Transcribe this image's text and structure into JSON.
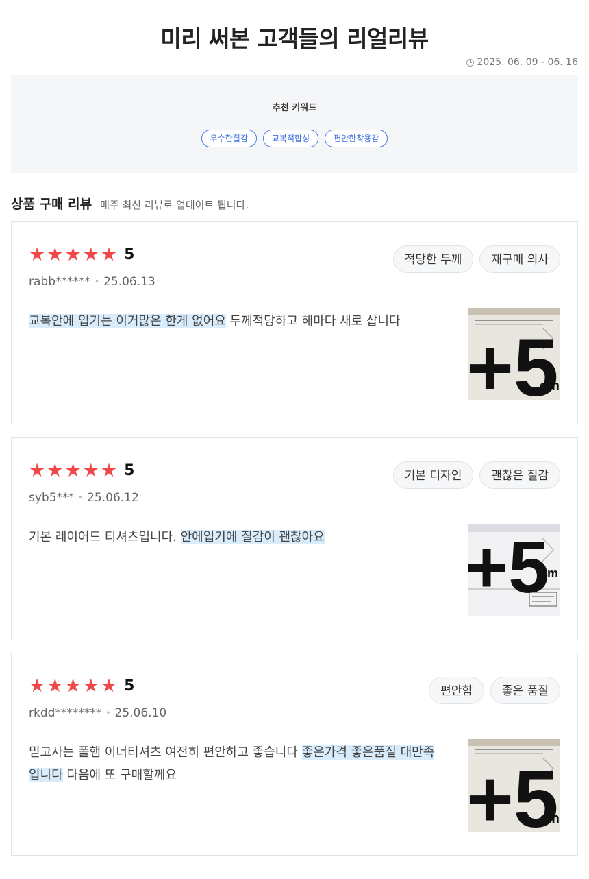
{
  "header": {
    "title": "미리 써본 고객들의 리얼리뷰",
    "date_range": "2025. 06. 09 - 06. 16"
  },
  "keywords": {
    "title": "추천 키워드",
    "tags": [
      "우수한질감",
      "교복적합성",
      "편안한착용감"
    ]
  },
  "section": {
    "title": "상품 구매 리뷰",
    "subtitle": "매주 최신 리뷰로 업데이트 됩니다."
  },
  "reviews": [
    {
      "rating": 5,
      "score_label": "5",
      "user": "rabb******",
      "date": "25.06.13",
      "chips": [
        "적당한 두께",
        "재구매 의사"
      ],
      "highlight_1": "교복안에 입기는 이거많은 한게 없어요",
      "text_1": " 두께적당하고 해마다 새로 삽니다",
      "highlight_2": "",
      "text_2": ""
    },
    {
      "rating": 5,
      "score_label": "5",
      "user": "syb5***",
      "date": "25.06.12",
      "chips": [
        "기본 디자인",
        "괜찮은 질감"
      ],
      "text_0": "기본 레이어드 티셔츠입니다. ",
      "highlight_1": "안에입기에 질감이 괜찮아요",
      "text_1": "",
      "highlight_2": "",
      "text_2": ""
    },
    {
      "rating": 5,
      "score_label": "5",
      "user": "rkdd********",
      "date": "25.06.10",
      "chips": [
        "편안함",
        "좋은 품질"
      ],
      "text_0": "믿고사는 폴햄 이너티셔츠 여전히 편안하고 좋습니다 ",
      "highlight_1": "좋은가격 좋은품질 대만족입니다",
      "text_1": " 다음에 또 구매할께요",
      "highlight_2": "",
      "text_2": ""
    }
  ],
  "thumb_text": {
    "big": "+5",
    "unit": "cm"
  },
  "colors": {
    "star": "#f04848",
    "tag_border": "#4a7be6",
    "highlight": "#d9ecfb"
  }
}
